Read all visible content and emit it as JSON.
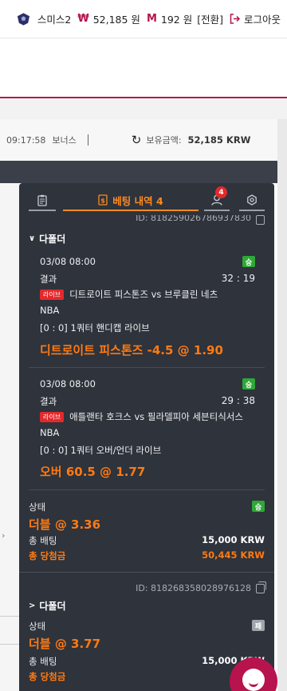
{
  "topbar": {
    "username": "스미스2",
    "won_symbol": "₩",
    "cash": "52,185 원",
    "m_symbol": "M",
    "mileage": "192 원",
    "convert": "[전환]",
    "logout": "로그아웃"
  },
  "status": {
    "time": "09:17:58",
    "bonus": "보너스",
    "holdings_label": "보유금액:",
    "holdings_value": "52,185 KRW"
  },
  "panel": {
    "tab_history_label": "베팅 내역 4",
    "user_badge": "4",
    "first_id": "ID: 818259026786937830",
    "bet1": {
      "type_label": "다폴더",
      "selections": [
        {
          "datetime": "03/08 08:00",
          "status_badge": "승",
          "result_label": "결과",
          "score": "32 : 19",
          "live_badge": "라이브",
          "match": "디트로이트 피스톤즈 vs 브루클린 네츠",
          "league": "NBA",
          "market": "[0 : 0] 1쿼터 핸디캡 라이브",
          "pick": "디트로이트 피스톤즈 -4.5 @ 1.90"
        },
        {
          "datetime": "03/08 08:00",
          "status_badge": "승",
          "result_label": "결과",
          "score": "29 : 38",
          "live_badge": "라이브",
          "match": "애틀랜타 호크스 vs 필라델피아 세븐티식서스",
          "league": "NBA",
          "market": "[0 : 0] 1쿼터 오버/언더 라이브",
          "pick": "오버 60.5 @ 1.77"
        }
      ],
      "state_label": "상태",
      "state_badge": "승",
      "combo": "더블 @ 3.36",
      "stake_label": "총 배팅",
      "stake": "15,000 KRW",
      "payout_label": "총 당첨금",
      "payout": "50,445 KRW"
    },
    "bet2": {
      "id": "ID: 818268358028976128",
      "type_label": "다폴더",
      "state_label": "상태",
      "state_badge": "패",
      "combo": "더블 @ 3.77",
      "stake_label": "총 배팅",
      "stake": "15,000 KRW",
      "payout_label": "총 당첨금"
    }
  },
  "colors": {
    "brand": "#b5134e",
    "panel_bg": "#2e333c",
    "accent_orange": "#ff7a12",
    "win_green": "#2ea836",
    "live_red": "#e3292c"
  }
}
